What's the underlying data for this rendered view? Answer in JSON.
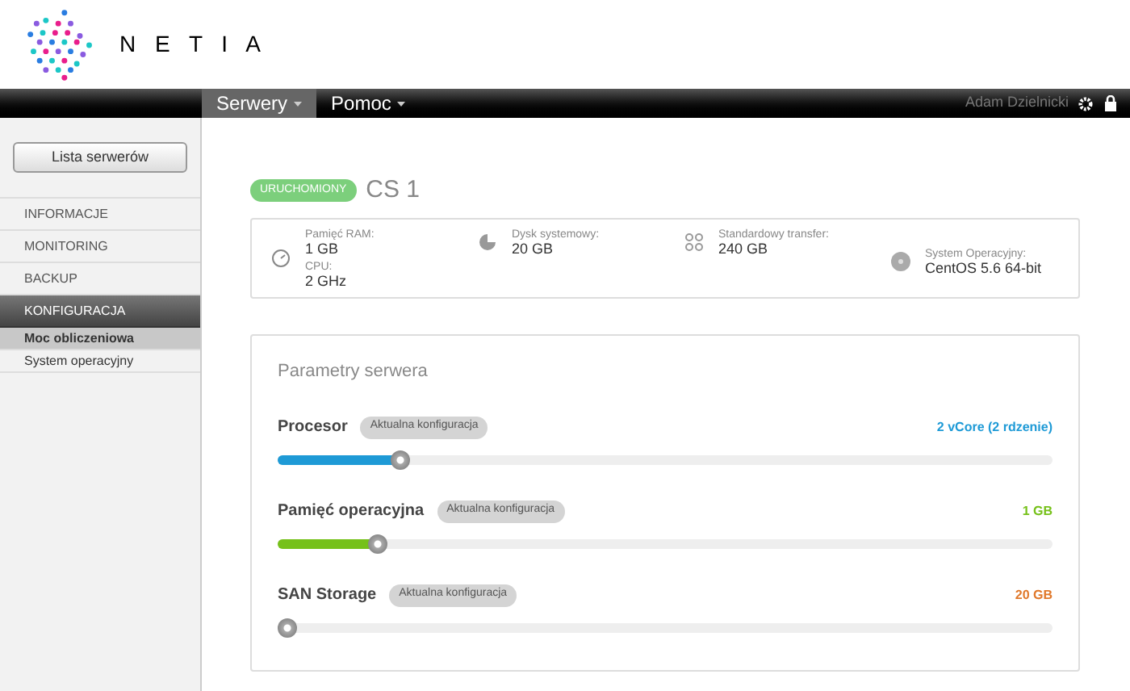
{
  "brand": {
    "name": "N E T I A"
  },
  "nav": [
    {
      "label": "Serwery",
      "selected": true
    },
    {
      "label": "Pomoc",
      "selected": false
    }
  ],
  "user": {
    "name": "Adam Dzielnicki"
  },
  "sidebar": {
    "button": "Lista serwerów",
    "items": [
      {
        "label": "INFORMACJE",
        "selected": false
      },
      {
        "label": "MONITORING",
        "selected": false
      },
      {
        "label": "BACKUP",
        "selected": false
      },
      {
        "label": "KONFIGURACJA",
        "selected": true,
        "children": [
          {
            "label": "Moc obliczeniowa",
            "selected": true
          },
          {
            "label": "System operacyjny",
            "selected": false
          }
        ]
      }
    ]
  },
  "server": {
    "status": "URUCHOMIONY",
    "name": "CS 1"
  },
  "stats": [
    {
      "kind": "clock",
      "fields": [
        {
          "label": "Pamięć RAM:",
          "value": "1 GB"
        },
        {
          "label": "CPU:",
          "value": "2 GHz"
        }
      ]
    },
    {
      "kind": "disk",
      "fields": [
        {
          "label": "Dysk systemowy:",
          "value": "20 GB"
        }
      ]
    },
    {
      "kind": "transfer",
      "fields": [
        {
          "label": "Standardowy transfer:",
          "value": "240 GB"
        }
      ]
    },
    {
      "kind": "os",
      "fields": [
        {
          "label": "System Operacyjny:",
          "value": "CentOS 5.6 64-bit"
        }
      ]
    }
  ],
  "parameters": {
    "title": "Parametry serwera",
    "items": [
      {
        "name": "Procesor",
        "badge": "Aktualna konfiguracja",
        "reading": "2 vCore (2 rdzenie)",
        "color": "#1e9ad6",
        "level": 0.15
      },
      {
        "name": "Pamięć operacyjna",
        "badge": "Aktualna konfiguracja",
        "reading": "1 GB",
        "color": "#76c11a",
        "level": 0.12
      },
      {
        "name": "SAN Storage",
        "badge": "Aktualna konfiguracja",
        "reading": "20 GB",
        "color": "#e0782a",
        "level": 0
      }
    ]
  }
}
